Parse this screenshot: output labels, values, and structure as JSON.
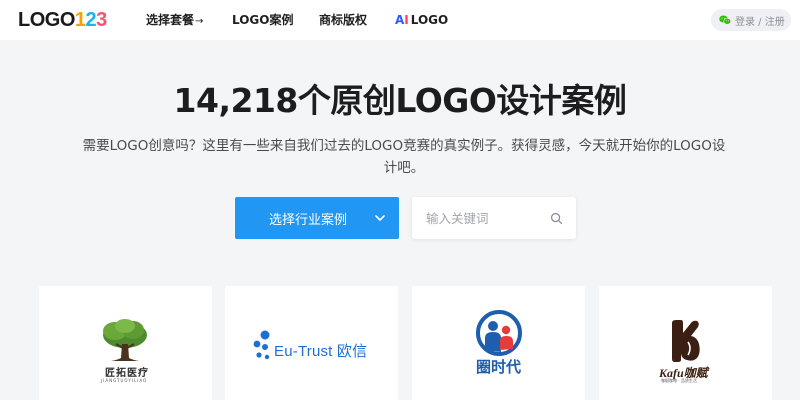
{
  "brand": {
    "logo_word": "LOGO",
    "logo_digit_1": "1",
    "logo_digit_2": "2",
    "logo_digit_3": "3"
  },
  "nav": {
    "items": [
      {
        "label": "选择套餐",
        "arrow": "→"
      },
      {
        "label": "LOGO案例"
      },
      {
        "label": "商标版权"
      },
      {
        "badge_a": "A",
        "badge_i": "I",
        "label": "LOGO"
      }
    ]
  },
  "auth": {
    "label": "登录 / 注册",
    "icon": "wechat-icon"
  },
  "hero": {
    "title": "14,218个原创LOGO设计案例",
    "description": "需要LOGO创意吗？这里有一些来自我们过去的LOGO竞赛的真实例子。获得灵感，今天就开始你的LOGO设计吧。"
  },
  "filters": {
    "industry_label": "选择行业案例",
    "search_placeholder": "输入关键词",
    "search_value": ""
  },
  "cases": [
    {
      "name": "匠拓医疗",
      "subtitle": "JIANGTUOYILIAO"
    },
    {
      "name": "Eu-Trust 欧信"
    },
    {
      "name": "圈时代"
    },
    {
      "name": "Kafu咖赋",
      "subtitle": "咖赋咖啡 · 品质生活"
    }
  ],
  "colors": {
    "accent": "#2196f3",
    "page_bg": "#f4f5f7",
    "card_bg": "#ffffff"
  }
}
